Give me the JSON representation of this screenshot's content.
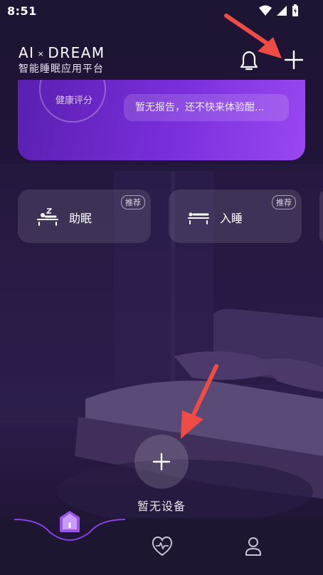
{
  "status_bar": {
    "time": "8:51"
  },
  "header": {
    "logo_left": "AI",
    "logo_sep": "×",
    "logo_right": "DREAM",
    "subtitle": "智能睡眠应用平台"
  },
  "score": {
    "value": "--",
    "label": "健康评分",
    "report_text": "暂无报告，还不快来体验酣..."
  },
  "modes": [
    {
      "label": "助眠",
      "badge": "推荐"
    },
    {
      "label": "入睡",
      "badge": "推荐"
    }
  ],
  "device": {
    "empty_label": "暂无设备"
  },
  "tabs": [
    "home",
    "health",
    "profile"
  ],
  "colors": {
    "accent": "#8b3fe8",
    "annotation_arrow": "#f04b45",
    "background": "#201538"
  }
}
